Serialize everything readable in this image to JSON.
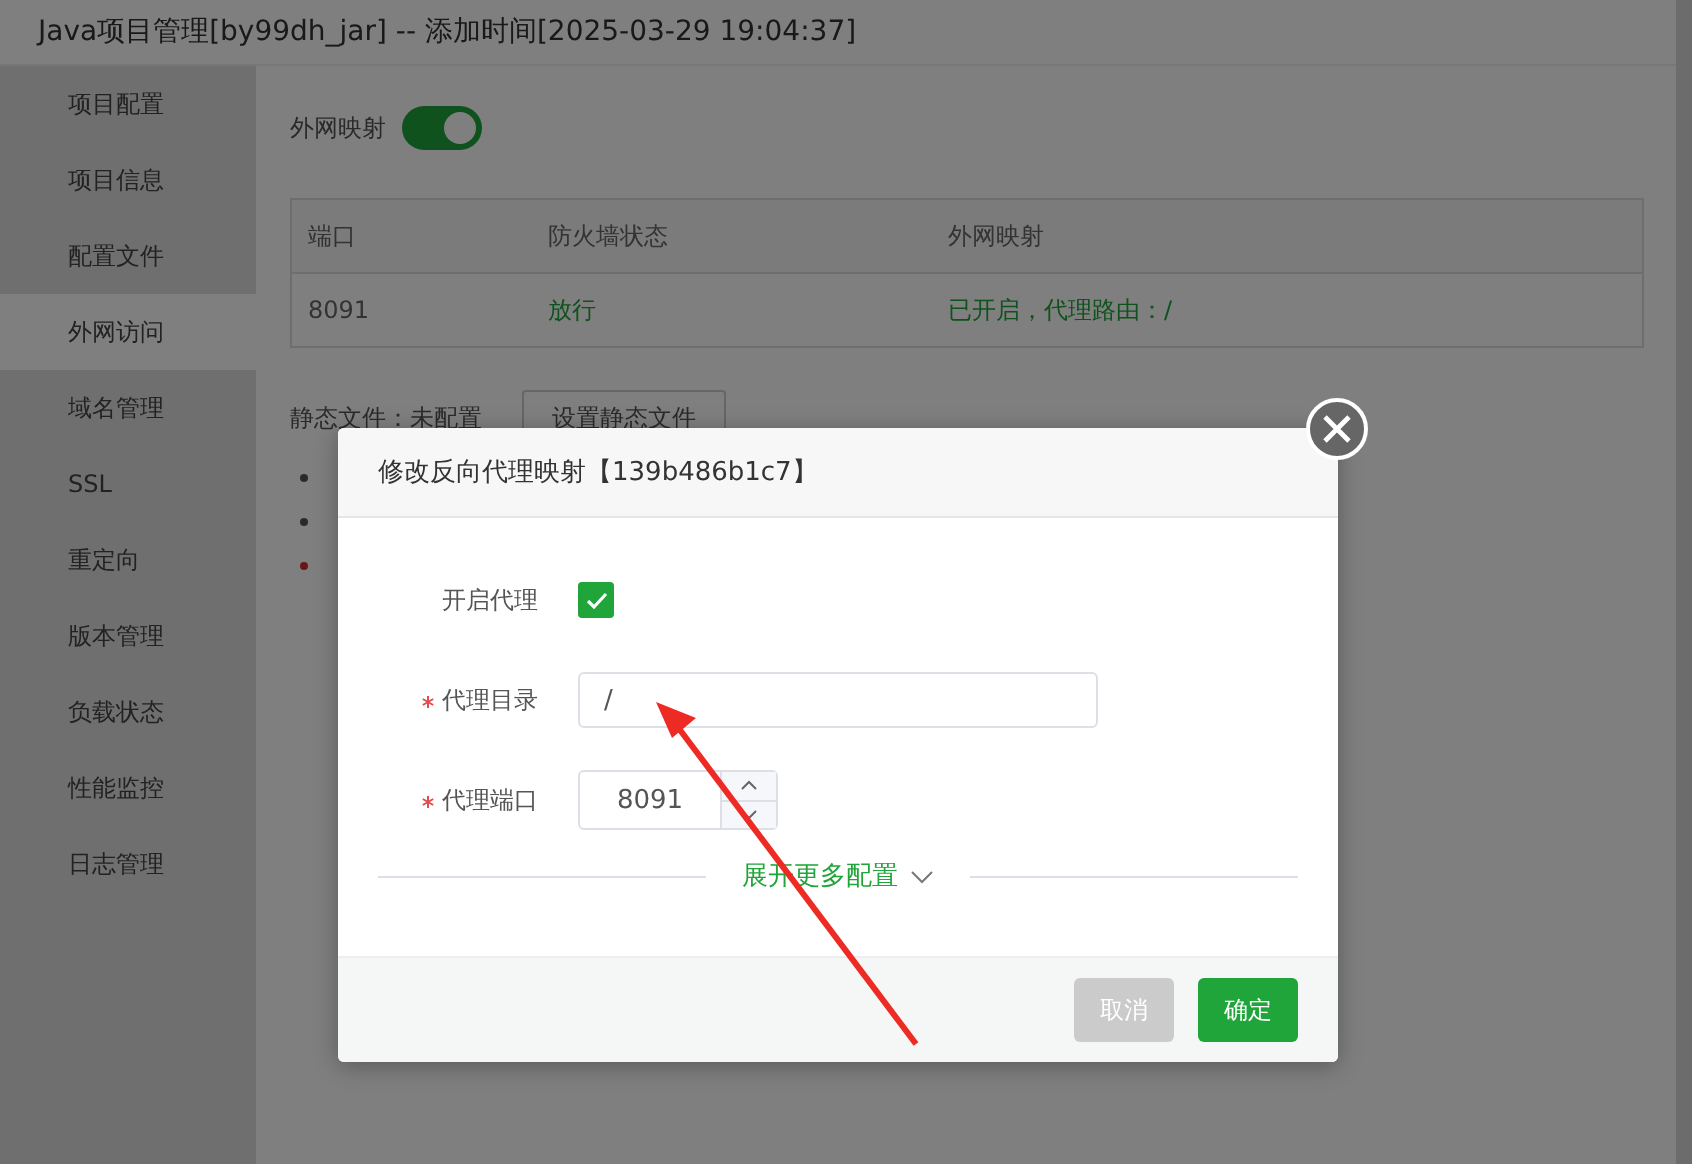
{
  "window": {
    "title": "Java项目管理[by99dh_jar] -- 添加时间[2025-03-29 19:04:37]"
  },
  "sidebar": {
    "items": [
      {
        "label": "项目配置",
        "selected": false
      },
      {
        "label": "项目信息",
        "selected": false
      },
      {
        "label": "配置文件",
        "selected": false
      },
      {
        "label": "外网访问",
        "selected": true
      },
      {
        "label": "域名管理",
        "selected": false
      },
      {
        "label": "SSL",
        "selected": false
      },
      {
        "label": "重定向",
        "selected": false
      },
      {
        "label": "版本管理",
        "selected": false
      },
      {
        "label": "负载状态",
        "selected": false
      },
      {
        "label": "性能监控",
        "selected": false
      },
      {
        "label": "日志管理",
        "selected": false
      }
    ]
  },
  "mapping_switch": {
    "label": "外网映射",
    "on": true
  },
  "table": {
    "columns": [
      "端口",
      "防火墙状态",
      "外网映射"
    ],
    "rows": [
      [
        "8091",
        "放行",
        "已开启，代理路由：/"
      ]
    ]
  },
  "static_files": {
    "label": "静态文件：未配置",
    "button": "设置静态文件"
  },
  "notes": [
    {
      "kind": "normal"
    },
    {
      "kind": "normal"
    },
    {
      "kind": "warning"
    }
  ],
  "dialog": {
    "title": "修改反向代理映射【139b486b1c7】",
    "enable": {
      "label": "开启代理",
      "checked": true
    },
    "fields": [
      {
        "label": "代理目录",
        "required": true,
        "kind": "text",
        "value": "/"
      },
      {
        "label": "代理端口",
        "required": true,
        "kind": "number",
        "value": "8091"
      }
    ],
    "expand": "展开更多配置",
    "buttons": [
      {
        "label": "取消",
        "disabled": true
      },
      {
        "label": "确定",
        "disabled": false
      }
    ]
  }
}
